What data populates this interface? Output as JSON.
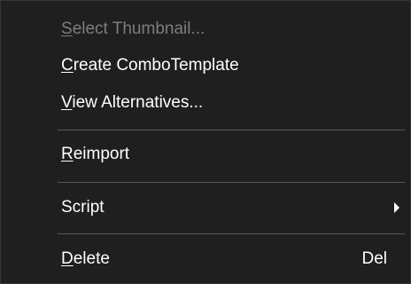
{
  "menu": {
    "items": [
      {
        "pre": "",
        "mnemonic": "S",
        "post": "elect Thumbnail...",
        "disabled": true,
        "shortcut": ""
      },
      {
        "pre": "",
        "mnemonic": "C",
        "post": "reate ComboTemplate",
        "disabled": false,
        "shortcut": ""
      },
      {
        "pre": "",
        "mnemonic": "V",
        "post": "iew Alternatives...",
        "disabled": false,
        "shortcut": ""
      },
      {
        "pre": "",
        "mnemonic": "R",
        "post": "eimport",
        "disabled": false,
        "shortcut": ""
      },
      {
        "pre": "Script",
        "mnemonic": "",
        "post": "",
        "disabled": false,
        "shortcut": "",
        "submenu": true
      },
      {
        "pre": "",
        "mnemonic": "D",
        "post": "elete",
        "disabled": false,
        "shortcut": "Del"
      }
    ],
    "icons": {
      "submenu_arrow": "chevron-right-icon"
    },
    "colors": {
      "background": "#1f1f1f",
      "text": "#ffffff",
      "disabled_text": "#7d7d7d",
      "separator": "#5a5a5a"
    }
  }
}
